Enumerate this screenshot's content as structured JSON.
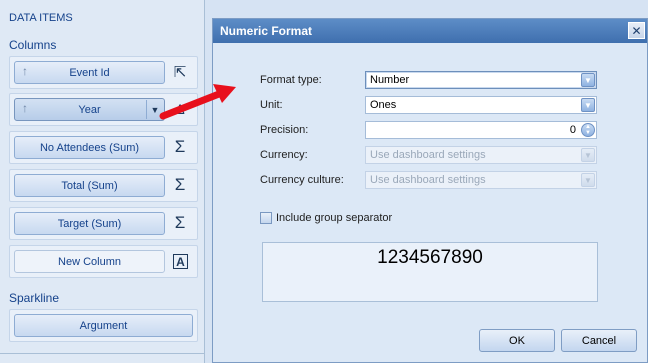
{
  "panel": {
    "title": "DATA ITEMS",
    "columns_label": "Columns",
    "columns": [
      {
        "label": "Event Id",
        "icon": "convert-icon",
        "glyph": "⇱"
      },
      {
        "label": "Year",
        "icon": "delta-icon",
        "glyph": "Δ"
      },
      {
        "label": "No Attendees (Sum)",
        "icon": "sigma-icon",
        "glyph": "Σ"
      },
      {
        "label": "Total (Sum)",
        "icon": "sigma-icon",
        "glyph": "Σ"
      },
      {
        "label": "Target (Sum)",
        "icon": "sigma-icon",
        "glyph": "Σ"
      },
      {
        "label": "New Column",
        "icon": "text-a-icon",
        "glyph": "A"
      }
    ],
    "sparkline_label": "Sparkline",
    "sparkline_button": "Argument"
  },
  "dialog": {
    "title": "Numeric Format",
    "close_glyph": "✕",
    "format_type": {
      "label": "Format type:",
      "value": "Number"
    },
    "unit": {
      "label": "Unit:",
      "value": "Ones"
    },
    "precision": {
      "label": "Precision:",
      "value": "0"
    },
    "currency": {
      "label": "Currency:",
      "value": "Use dashboard settings"
    },
    "currency_culture": {
      "label": "Currency culture:",
      "value": "Use dashboard settings"
    },
    "include_group_separator": {
      "label": "Include group separator",
      "checked": false
    },
    "preview": "1234567890",
    "ok_label": "OK",
    "cancel_label": "Cancel"
  },
  "colors": {
    "callout_arrow": "#e8101c",
    "titlebar": "#4a7cbc"
  }
}
